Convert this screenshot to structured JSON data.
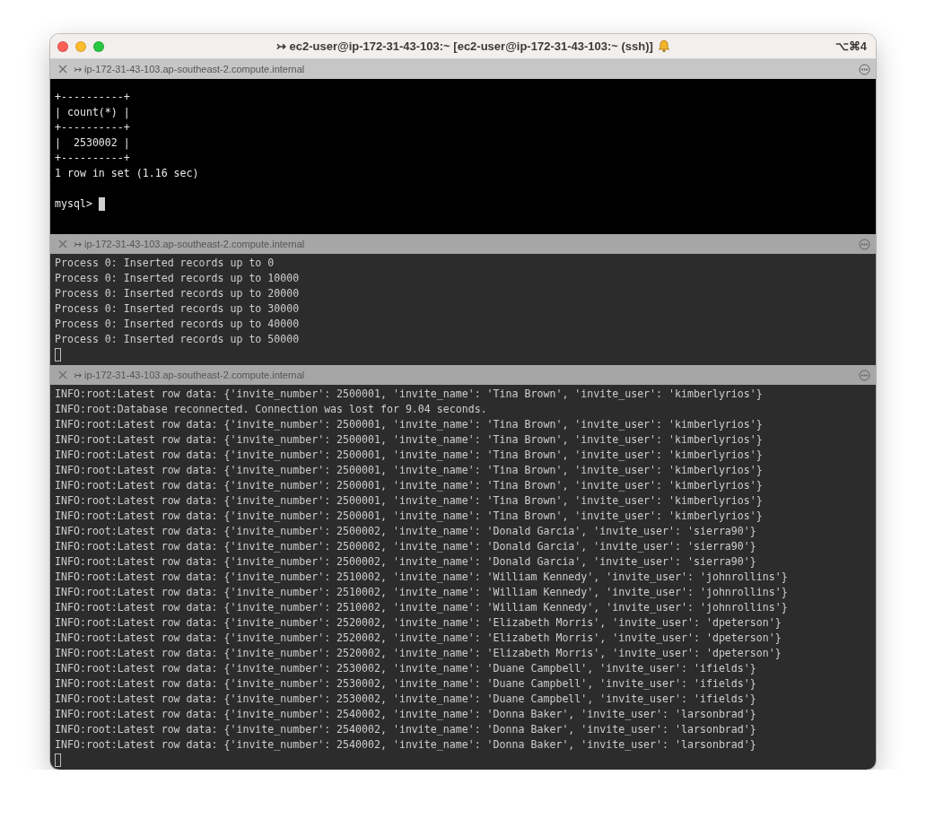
{
  "window": {
    "title": "↣ ec2-user@ip-172-31-43-103:~ [ec2-user@ip-172-31-43-103:~ (ssh)]",
    "shortcut": "⌥⌘4"
  },
  "panes": [
    {
      "arrow": "↣",
      "title": "ip-172-31-43-103.ap-southeast-2.compute.internal",
      "active": true,
      "lines": [
        "+----------+",
        "| count(*) |",
        "+----------+",
        "|  2530002 |",
        "+----------+",
        "1 row in set (1.16 sec)"
      ],
      "prompt": "mysql>"
    },
    {
      "arrow": "↣",
      "title": "ip-172-31-43-103.ap-southeast-2.compute.internal",
      "active": false,
      "lines": [
        "Process 0: Inserted records up to 0",
        "Process 0: Inserted records up to 10000",
        "Process 0: Inserted records up to 20000",
        "Process 0: Inserted records up to 30000",
        "Process 0: Inserted records up to 40000",
        "Process 0: Inserted records up to 50000"
      ]
    },
    {
      "arrow": "↣",
      "title": "ip-172-31-43-103.ap-southeast-2.compute.internal",
      "active": false,
      "lines": [
        "INFO:root:Latest row data: {'invite_number': 2500001, 'invite_name': 'Tina Brown', 'invite_user': 'kimberlyrios'}",
        "INFO:root:Database reconnected. Connection was lost for 9.04 seconds.",
        "INFO:root:Latest row data: {'invite_number': 2500001, 'invite_name': 'Tina Brown', 'invite_user': 'kimberlyrios'}",
        "INFO:root:Latest row data: {'invite_number': 2500001, 'invite_name': 'Tina Brown', 'invite_user': 'kimberlyrios'}",
        "INFO:root:Latest row data: {'invite_number': 2500001, 'invite_name': 'Tina Brown', 'invite_user': 'kimberlyrios'}",
        "INFO:root:Latest row data: {'invite_number': 2500001, 'invite_name': 'Tina Brown', 'invite_user': 'kimberlyrios'}",
        "INFO:root:Latest row data: {'invite_number': 2500001, 'invite_name': 'Tina Brown', 'invite_user': 'kimberlyrios'}",
        "INFO:root:Latest row data: {'invite_number': 2500001, 'invite_name': 'Tina Brown', 'invite_user': 'kimberlyrios'}",
        "INFO:root:Latest row data: {'invite_number': 2500001, 'invite_name': 'Tina Brown', 'invite_user': 'kimberlyrios'}",
        "INFO:root:Latest row data: {'invite_number': 2500002, 'invite_name': 'Donald Garcia', 'invite_user': 'sierra90'}",
        "INFO:root:Latest row data: {'invite_number': 2500002, 'invite_name': 'Donald Garcia', 'invite_user': 'sierra90'}",
        "INFO:root:Latest row data: {'invite_number': 2500002, 'invite_name': 'Donald Garcia', 'invite_user': 'sierra90'}",
        "INFO:root:Latest row data: {'invite_number': 2510002, 'invite_name': 'William Kennedy', 'invite_user': 'johnrollins'}",
        "INFO:root:Latest row data: {'invite_number': 2510002, 'invite_name': 'William Kennedy', 'invite_user': 'johnrollins'}",
        "INFO:root:Latest row data: {'invite_number': 2510002, 'invite_name': 'William Kennedy', 'invite_user': 'johnrollins'}",
        "INFO:root:Latest row data: {'invite_number': 2520002, 'invite_name': 'Elizabeth Morris', 'invite_user': 'dpeterson'}",
        "INFO:root:Latest row data: {'invite_number': 2520002, 'invite_name': 'Elizabeth Morris', 'invite_user': 'dpeterson'}",
        "INFO:root:Latest row data: {'invite_number': 2520002, 'invite_name': 'Elizabeth Morris', 'invite_user': 'dpeterson'}",
        "INFO:root:Latest row data: {'invite_number': 2530002, 'invite_name': 'Duane Campbell', 'invite_user': 'ifields'}",
        "INFO:root:Latest row data: {'invite_number': 2530002, 'invite_name': 'Duane Campbell', 'invite_user': 'ifields'}",
        "INFO:root:Latest row data: {'invite_number': 2530002, 'invite_name': 'Duane Campbell', 'invite_user': 'ifields'}",
        "INFO:root:Latest row data: {'invite_number': 2540002, 'invite_name': 'Donna Baker', 'invite_user': 'larsonbrad'}",
        "INFO:root:Latest row data: {'invite_number': 2540002, 'invite_name': 'Donna Baker', 'invite_user': 'larsonbrad'}",
        "INFO:root:Latest row data: {'invite_number': 2540002, 'invite_name': 'Donna Baker', 'invite_user': 'larsonbrad'}"
      ]
    }
  ]
}
